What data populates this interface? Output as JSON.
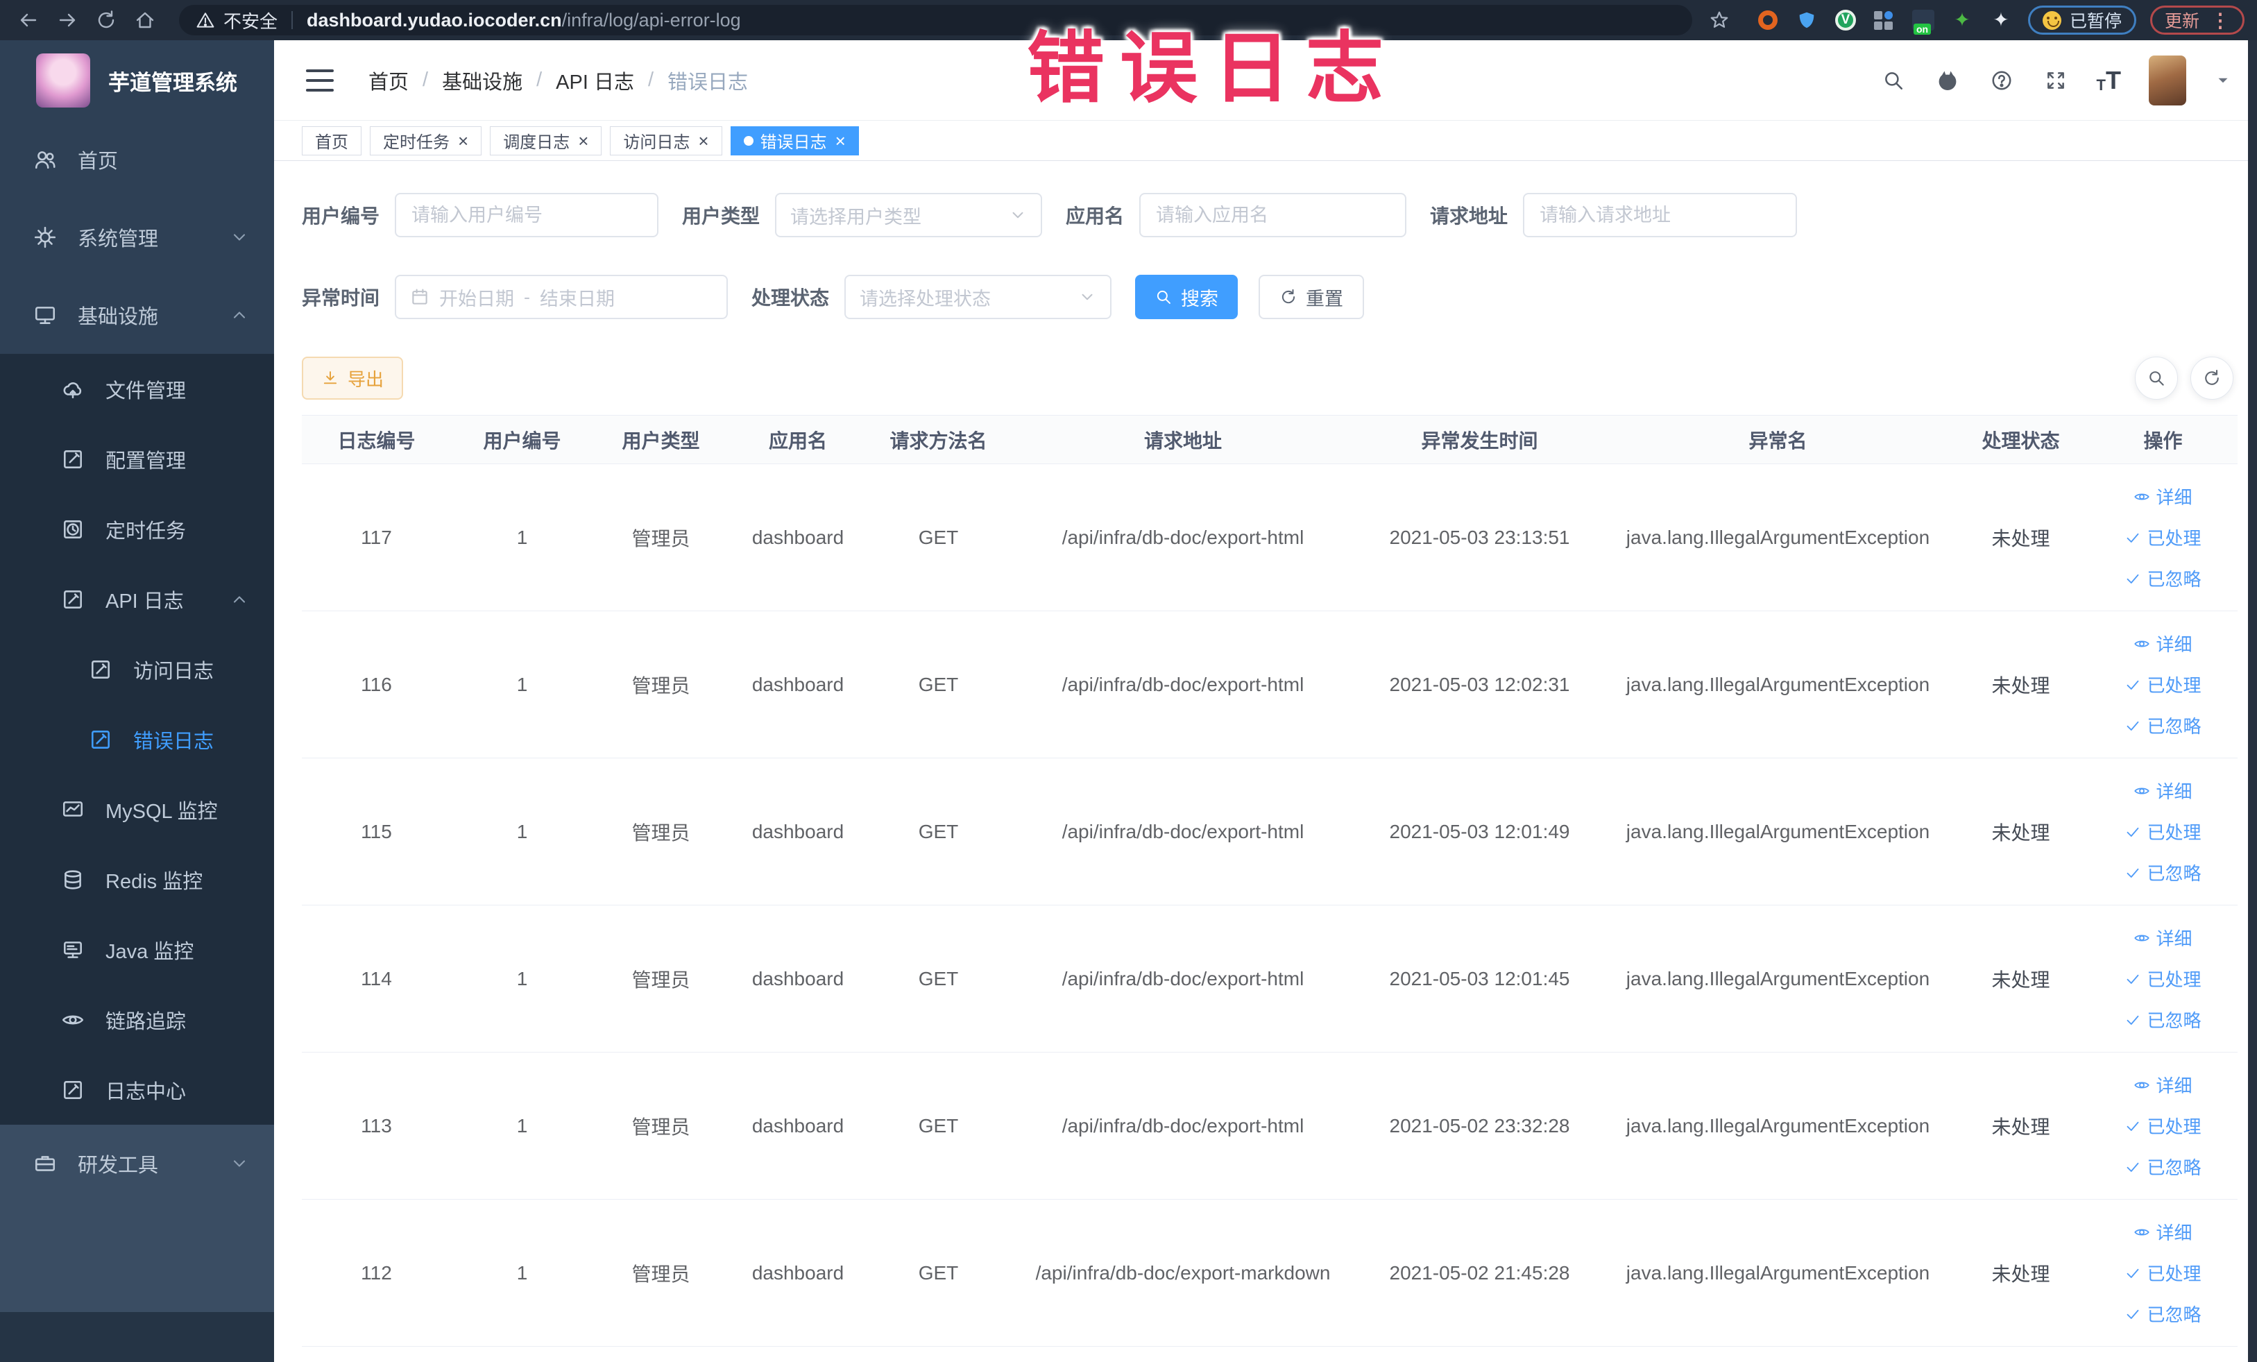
{
  "browser": {
    "security_label": "不安全",
    "url_host": "dashboard.yudao.iocoder.cn",
    "url_path": "/infra/log/api-error-log",
    "paused_badge": "已暂停",
    "update_label": "更新"
  },
  "annotation": {
    "text": "错误日志",
    "color": "#ea3360"
  },
  "sidebar": {
    "title": "芋道管理系统",
    "items": [
      {
        "label": "首页"
      },
      {
        "label": "系统管理"
      },
      {
        "label": "基础设施"
      },
      {
        "label": "文件管理"
      },
      {
        "label": "配置管理"
      },
      {
        "label": "定时任务"
      },
      {
        "label": "API 日志"
      },
      {
        "label": "访问日志"
      },
      {
        "label": "错误日志",
        "active": true
      },
      {
        "label": "MySQL 监控"
      },
      {
        "label": "Redis 监控"
      },
      {
        "label": "Java 监控"
      },
      {
        "label": "链路追踪"
      },
      {
        "label": "日志中心"
      },
      {
        "label": "研发工具"
      }
    ]
  },
  "header": {
    "breadcrumb": [
      "首页",
      "基础设施",
      "API 日志",
      "错误日志"
    ]
  },
  "tabs": [
    {
      "label": "首页"
    },
    {
      "label": "定时任务"
    },
    {
      "label": "调度日志"
    },
    {
      "label": "访问日志"
    },
    {
      "label": "错误日志",
      "active": true
    }
  ],
  "filters": {
    "user_id": {
      "label": "用户编号",
      "placeholder": "请输入用户编号"
    },
    "user_type": {
      "label": "用户类型",
      "placeholder": "请选择用户类型"
    },
    "app_name": {
      "label": "应用名",
      "placeholder": "请输入应用名"
    },
    "request_url": {
      "label": "请求地址",
      "placeholder": "请输入请求地址"
    },
    "exception_time": {
      "label": "异常时间",
      "start_placeholder": "开始日期",
      "separator": "-",
      "end_placeholder": "结束日期"
    },
    "process_status": {
      "label": "处理状态",
      "placeholder": "请选择处理状态"
    },
    "search_button": "搜索",
    "reset_button": "重置"
  },
  "toolbar": {
    "export_button": "导出"
  },
  "table": {
    "columns": [
      "日志编号",
      "用户编号",
      "用户类型",
      "应用名",
      "请求方法名",
      "请求地址",
      "异常发生时间",
      "异常名",
      "处理状态",
      "操作"
    ],
    "actions": [
      "详细",
      "已处理",
      "已忽略"
    ],
    "rows": [
      {
        "id": "117",
        "user_id": "1",
        "user_type": "管理员",
        "app": "dashboard",
        "method": "GET",
        "url": "/api/infra/db-doc/export-html",
        "time": "2021-05-03 23:13:51",
        "exception": "java.lang.IllegalArgumentException",
        "status": "未处理"
      },
      {
        "id": "116",
        "user_id": "1",
        "user_type": "管理员",
        "app": "dashboard",
        "method": "GET",
        "url": "/api/infra/db-doc/export-html",
        "time": "2021-05-03 12:02:31",
        "exception": "java.lang.IllegalArgumentException",
        "status": "未处理"
      },
      {
        "id": "115",
        "user_id": "1",
        "user_type": "管理员",
        "app": "dashboard",
        "method": "GET",
        "url": "/api/infra/db-doc/export-html",
        "time": "2021-05-03 12:01:49",
        "exception": "java.lang.IllegalArgumentException",
        "status": "未处理"
      },
      {
        "id": "114",
        "user_id": "1",
        "user_type": "管理员",
        "app": "dashboard",
        "method": "GET",
        "url": "/api/infra/db-doc/export-html",
        "time": "2021-05-03 12:01:45",
        "exception": "java.lang.IllegalArgumentException",
        "status": "未处理"
      },
      {
        "id": "113",
        "user_id": "1",
        "user_type": "管理员",
        "app": "dashboard",
        "method": "GET",
        "url": "/api/infra/db-doc/export-html",
        "time": "2021-05-02 23:32:28",
        "exception": "java.lang.IllegalArgumentException",
        "status": "未处理"
      },
      {
        "id": "112",
        "user_id": "1",
        "user_type": "管理员",
        "app": "dashboard",
        "method": "GET",
        "url": "/api/infra/db-doc/export-markdown",
        "time": "2021-05-02 21:45:28",
        "exception": "java.lang.IllegalArgumentException",
        "status": "未处理"
      }
    ]
  },
  "colors": {
    "accent": "#409EFF",
    "warning": "#e6a23c",
    "sidebar_bg": "#304156",
    "submenu_bg": "#1f2d3d"
  }
}
